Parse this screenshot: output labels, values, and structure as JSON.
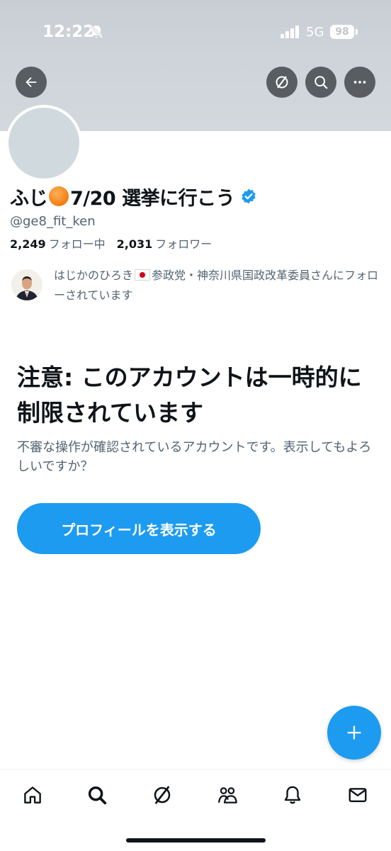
{
  "status_bar": {
    "time": "12:22",
    "network": "5G",
    "battery": "98"
  },
  "header": {
    "back_icon": "arrow-left-icon",
    "grok_icon": "slash-circle-icon",
    "search_icon": "search-icon",
    "more_icon": "more-horizontal-icon"
  },
  "profile": {
    "name_prefix": "ふじ",
    "name_suffix": "7/20 選挙に行こう",
    "handle": "@ge8_fit_ken",
    "following_count": "2,249",
    "following_label": "フォロー中",
    "followers_count": "2,031",
    "followers_label": "フォロワー",
    "followed_by_name": "はじかのひろき",
    "followed_by_rest": "参政党・神奈川県国政改革委員さんにフォローされています"
  },
  "warning": {
    "title": "注意: このアカウントは一時的に制限されています",
    "description": "不審な操作が確認されているアカウントです。表示してもよろしいですか？",
    "button_label": "プロフィールを表示する"
  },
  "colors": {
    "accent": "#1d9bf0",
    "text": "#0f1419",
    "secondary_text": "#536471"
  },
  "tab_bar": [
    "home-icon",
    "search-icon",
    "grok-icon",
    "communities-icon",
    "notifications-icon",
    "messages-icon"
  ]
}
